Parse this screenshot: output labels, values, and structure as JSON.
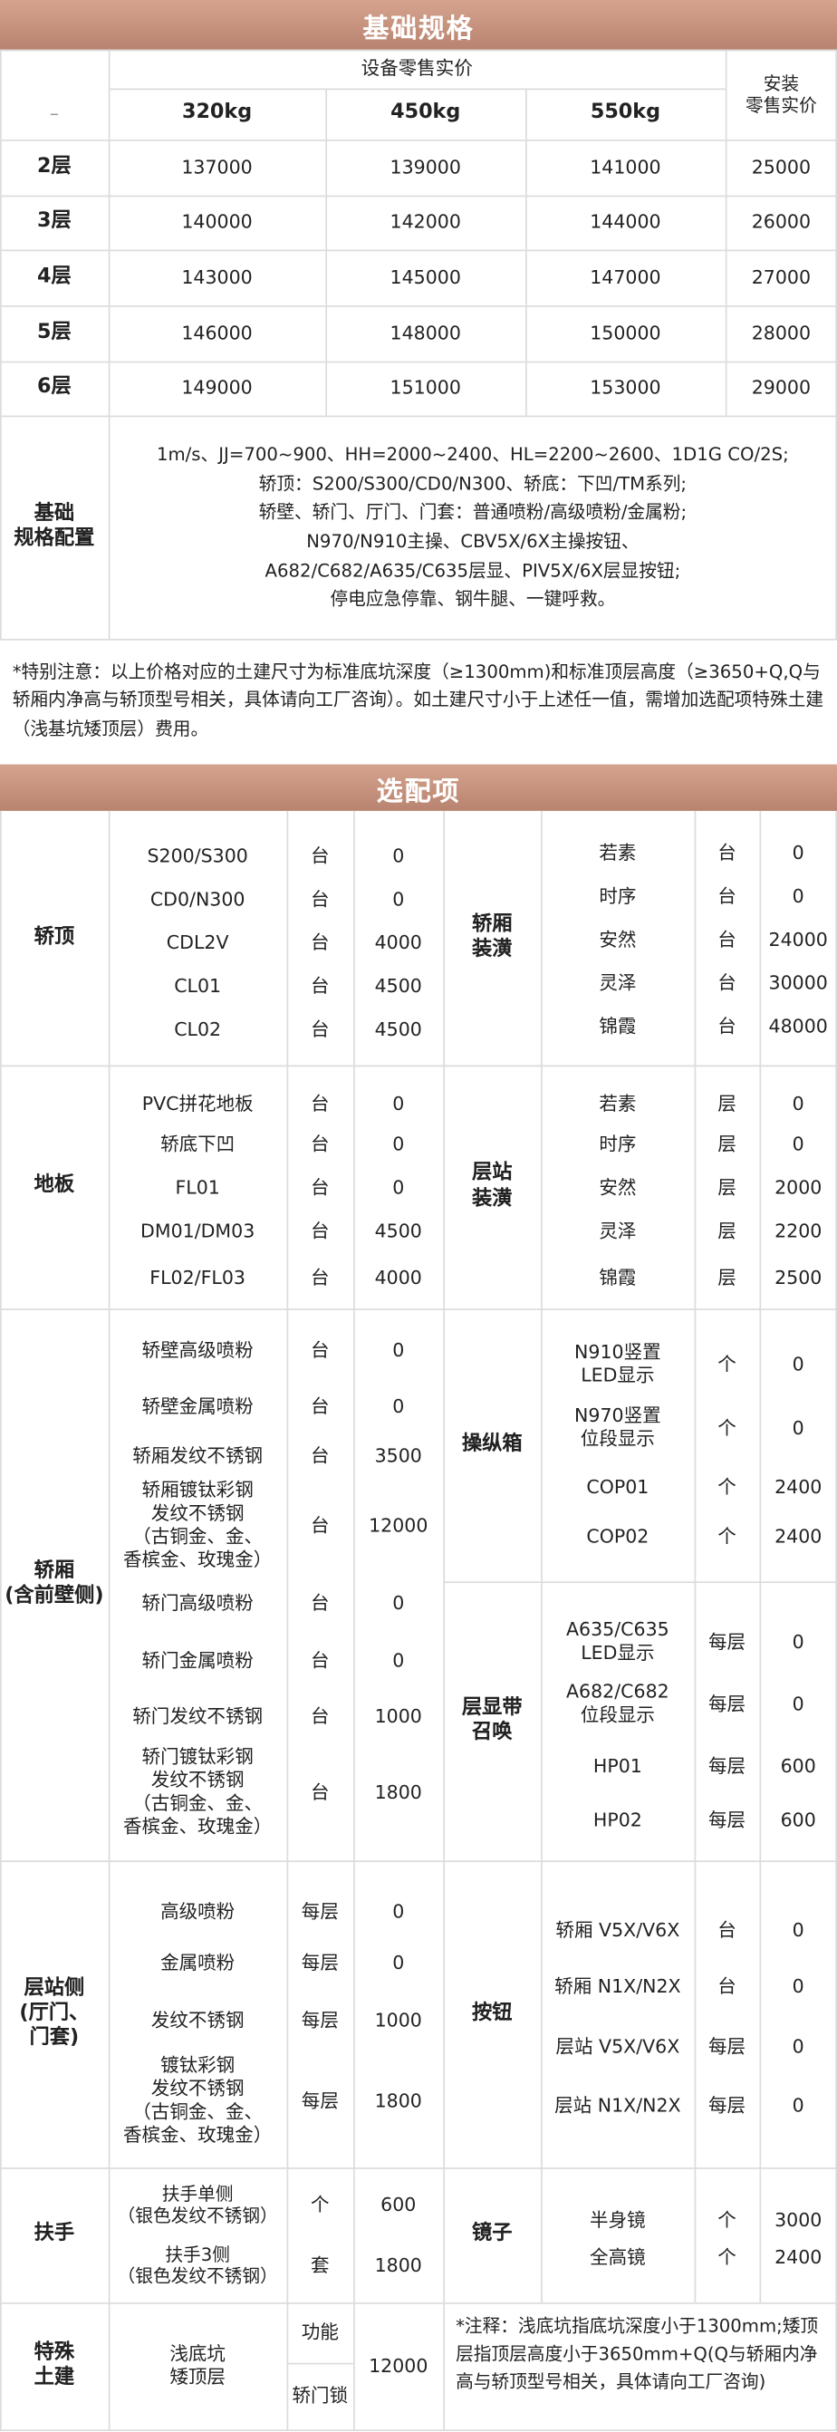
{
  "basic": {
    "title": "基础规格",
    "retail_header": "设备零售实价",
    "install_header": "安装\n零售实价",
    "dash": "–",
    "capacities": [
      "320kg",
      "450kg",
      "550kg"
    ],
    "rows": [
      {
        "floor": "2层",
        "p320": "137000",
        "p450": "139000",
        "p550": "141000",
        "install": "25000"
      },
      {
        "floor": "3层",
        "p320": "140000",
        "p450": "142000",
        "p550": "144000",
        "install": "26000"
      },
      {
        "floor": "4层",
        "p320": "143000",
        "p450": "145000",
        "p550": "147000",
        "install": "27000"
      },
      {
        "floor": "5层",
        "p320": "146000",
        "p450": "148000",
        "p550": "150000",
        "install": "28000"
      },
      {
        "floor": "6层",
        "p320": "149000",
        "p450": "151000",
        "p550": "153000",
        "install": "29000"
      }
    ],
    "config_label": "基础\n规格配置",
    "config_lines": [
      "1m/s、JJ=700~900、HH=2000~2400、HL=2200~2600、1D1G CO/2S;",
      "轿顶：S200/S300/CD0/N300、轿底：下凹/TM系列;",
      "轿壁、轿门、厅门、门套：普通喷粉/高级喷粉/金属粉;",
      "N970/N910主操、CBV5X/6X主操按钮、",
      "A682/C682/A635/C635层显、PIV5X/6X层显按钮;",
      "停电应急停靠、钢牛腿、一键呼救。"
    ],
    "special_note": "*特别注意：以上价格对应的土建尺寸为标准底坑深度（≥1300mm)和标准顶层高度（≥3650+Q,Q与轿厢内净高与轿顶型号相关，具体请向工厂咨询）。如土建尺寸小于上述任一值，需增加选配项特殊土建（浅基坑矮顶层）费用。"
  },
  "options": {
    "title": "选配项",
    "car_top": {
      "label": "轿顶",
      "items": [
        {
          "name": "S200/S300",
          "unit": "台",
          "price": "0"
        },
        {
          "name": "CD0/N300",
          "unit": "台",
          "price": "0"
        },
        {
          "name": "CDL2V",
          "unit": "台",
          "price": "4000"
        },
        {
          "name": "CL01",
          "unit": "台",
          "price": "4500"
        },
        {
          "name": "CL02",
          "unit": "台",
          "price": "4500"
        }
      ]
    },
    "car_decor": {
      "label": "轿厢\n装潢",
      "items": [
        {
          "name": "若素",
          "unit": "台",
          "price": "0"
        },
        {
          "name": "时序",
          "unit": "台",
          "price": "0"
        },
        {
          "name": "安然",
          "unit": "台",
          "price": "24000"
        },
        {
          "name": "灵泽",
          "unit": "台",
          "price": "30000"
        },
        {
          "name": "锦霞",
          "unit": "台",
          "price": "48000"
        }
      ]
    },
    "floor": {
      "label": "地板",
      "items": [
        {
          "name": "PVC拼花地板",
          "unit": "台",
          "price": "0"
        },
        {
          "name": "轿底下凹",
          "unit": "台",
          "price": "0"
        },
        {
          "name": "FL01",
          "unit": "台",
          "price": "0"
        },
        {
          "name": "DM01/DM03",
          "unit": "台",
          "price": "4500"
        },
        {
          "name": "FL02/FL03",
          "unit": "台",
          "price": "4000"
        }
      ]
    },
    "landing_decor": {
      "label": "层站\n装潢",
      "items": [
        {
          "name": "若素",
          "unit": "层",
          "price": "0"
        },
        {
          "name": "时序",
          "unit": "层",
          "price": "0"
        },
        {
          "name": "安然",
          "unit": "层",
          "price": "2000"
        },
        {
          "name": "灵泽",
          "unit": "层",
          "price": "2200"
        },
        {
          "name": "锦霞",
          "unit": "层",
          "price": "2500"
        }
      ]
    },
    "car": {
      "label": "轿厢\n(含前壁侧)",
      "items": [
        {
          "name": "轿壁高级喷粉",
          "unit": "台",
          "price": "0"
        },
        {
          "name": "轿壁金属喷粉",
          "unit": "台",
          "price": "0"
        },
        {
          "name": "轿厢发纹不锈钢",
          "unit": "台",
          "price": "3500"
        },
        {
          "name": "轿厢镀钛彩钢\n发纹不锈钢\n（古铜金、金、\n香槟金、玫瑰金）",
          "unit": "台",
          "price": "12000"
        },
        {
          "name": "轿门高级喷粉",
          "unit": "台",
          "price": "0"
        },
        {
          "name": "轿门金属喷粉",
          "unit": "台",
          "price": "0"
        },
        {
          "name": "轿门发纹不锈钢",
          "unit": "台",
          "price": "1000"
        },
        {
          "name": "轿门镀钛彩钢\n发纹不锈钢\n（古铜金、金、\n香槟金、玫瑰金）",
          "unit": "台",
          "price": "1800"
        }
      ]
    },
    "cop": {
      "label": "操纵箱",
      "items": [
        {
          "name": "N910竖置\nLED显示",
          "unit": "个",
          "price": "0"
        },
        {
          "name": "N970竖置\n位段显示",
          "unit": "个",
          "price": "0"
        },
        {
          "name": "COP01",
          "unit": "个",
          "price": "2400"
        },
        {
          "name": "COP02",
          "unit": "个",
          "price": "2400"
        }
      ]
    },
    "hall_display": {
      "label": "层显带\n召唤",
      "items": [
        {
          "name": "A635/C635\nLED显示",
          "unit": "每层",
          "price": "0"
        },
        {
          "name": "A682/C682\n位段显示",
          "unit": "每层",
          "price": "0"
        },
        {
          "name": "HP01",
          "unit": "每层",
          "price": "600"
        },
        {
          "name": "HP02",
          "unit": "每层",
          "price": "600"
        }
      ]
    },
    "landing_side": {
      "label": "层站侧\n(厅门、\n门套)",
      "items": [
        {
          "name": "高级喷粉",
          "unit": "每层",
          "price": "0"
        },
        {
          "name": "金属喷粉",
          "unit": "每层",
          "price": "0"
        },
        {
          "name": "发纹不锈钢",
          "unit": "每层",
          "price": "1000"
        },
        {
          "name": "镀钛彩钢\n发纹不锈钢\n（古铜金、金、\n香槟金、玫瑰金）",
          "unit": "每层",
          "price": "1800"
        }
      ]
    },
    "buttons": {
      "label": "按钮",
      "items": [
        {
          "name": "轿厢 V5X/V6X",
          "unit": "台",
          "price": "0"
        },
        {
          "name": "轿厢 N1X/N2X",
          "unit": "台",
          "price": "0"
        },
        {
          "name": "层站 V5X/V6X",
          "unit": "每层",
          "price": "0"
        },
        {
          "name": "层站 N1X/N2X",
          "unit": "每层",
          "price": "0"
        }
      ]
    },
    "handrail": {
      "label": "扶手",
      "items": [
        {
          "name": "扶手单侧\n（银色发纹不锈钢）",
          "unit": "个",
          "price": "600"
        },
        {
          "name": "扶手3侧\n（银色发纹不锈钢）",
          "unit": "套",
          "price": "1800"
        }
      ]
    },
    "mirror": {
      "label": "镜子",
      "items": [
        {
          "name": "半身镜",
          "unit": "个",
          "price": "3000"
        },
        {
          "name": "全高镜",
          "unit": "个",
          "price": "2400"
        }
      ]
    },
    "special": {
      "label": "特殊\n土建",
      "name": "浅底坑\n矮顶层",
      "unit1": "功能",
      "unit2": "轿门锁",
      "price": "12000",
      "note": "*注释：浅底坑指底坑深度小于1300mm;矮顶层指顶层高度小于3650mm+Q(Q与轿厢内净高与轿顶型号相关，具体请向工厂咨询)"
    }
  }
}
